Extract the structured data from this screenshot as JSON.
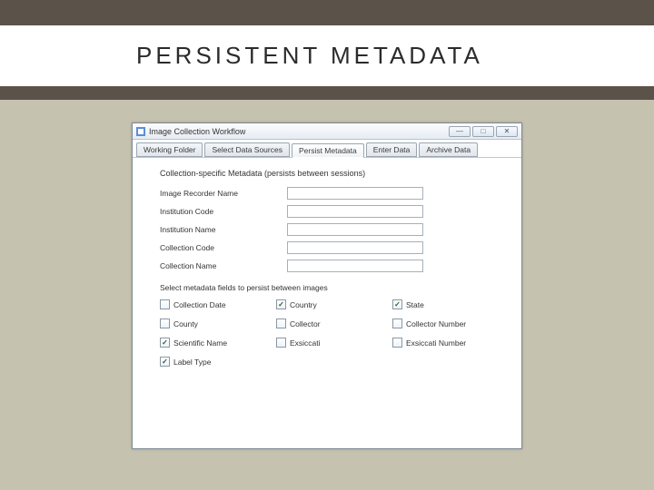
{
  "slide": {
    "title": "PERSISTENT METADATA"
  },
  "window": {
    "title": "Image Collection Workflow",
    "controls": {
      "min": "—",
      "max": "□",
      "close": "✕"
    }
  },
  "tabs": [
    {
      "label": "Working Folder",
      "active": false
    },
    {
      "label": "Select Data Sources",
      "active": false
    },
    {
      "label": "Persist Metadata",
      "active": true
    },
    {
      "label": "Enter Data",
      "active": false
    },
    {
      "label": "Archive Data",
      "active": false
    }
  ],
  "section_heading": "Collection-specific Metadata (persists between sessions)",
  "fields": [
    {
      "label": "Image Recorder Name",
      "value": ""
    },
    {
      "label": "Institution Code",
      "value": ""
    },
    {
      "label": "Institution Name",
      "value": ""
    },
    {
      "label": "Collection Code",
      "value": ""
    },
    {
      "label": "Collection Name",
      "value": ""
    }
  ],
  "persist_heading": "Select metadata fields to persist between images",
  "checks": [
    {
      "label": "Collection Date",
      "checked": false
    },
    {
      "label": "Country",
      "checked": true
    },
    {
      "label": "State",
      "checked": true
    },
    {
      "label": "County",
      "checked": false
    },
    {
      "label": "Collector",
      "checked": false
    },
    {
      "label": "Collector Number",
      "checked": false
    },
    {
      "label": "Scientific Name",
      "checked": true
    },
    {
      "label": "Exsiccati",
      "checked": false
    },
    {
      "label": "Exsiccati Number",
      "checked": false
    },
    {
      "label": "Label Type",
      "checked": true
    }
  ]
}
